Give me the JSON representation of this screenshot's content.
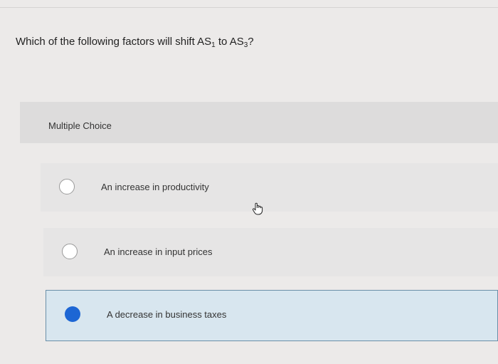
{
  "question": {
    "prefix": "Which of the following factors will shift AS",
    "sub1": "1",
    "middle": " to AS",
    "sub2": "3",
    "suffix": "?"
  },
  "section_label": "Multiple Choice",
  "options": [
    {
      "label": "An increase in productivity",
      "selected": false
    },
    {
      "label": "An increase in input prices",
      "selected": false
    },
    {
      "label": "A decrease in business taxes",
      "selected": true
    }
  ],
  "colors": {
    "selected_fill": "#1d66d4",
    "selected_background": "#d8e6ef"
  },
  "icons": {
    "cursor": "hand-pointer-icon"
  }
}
